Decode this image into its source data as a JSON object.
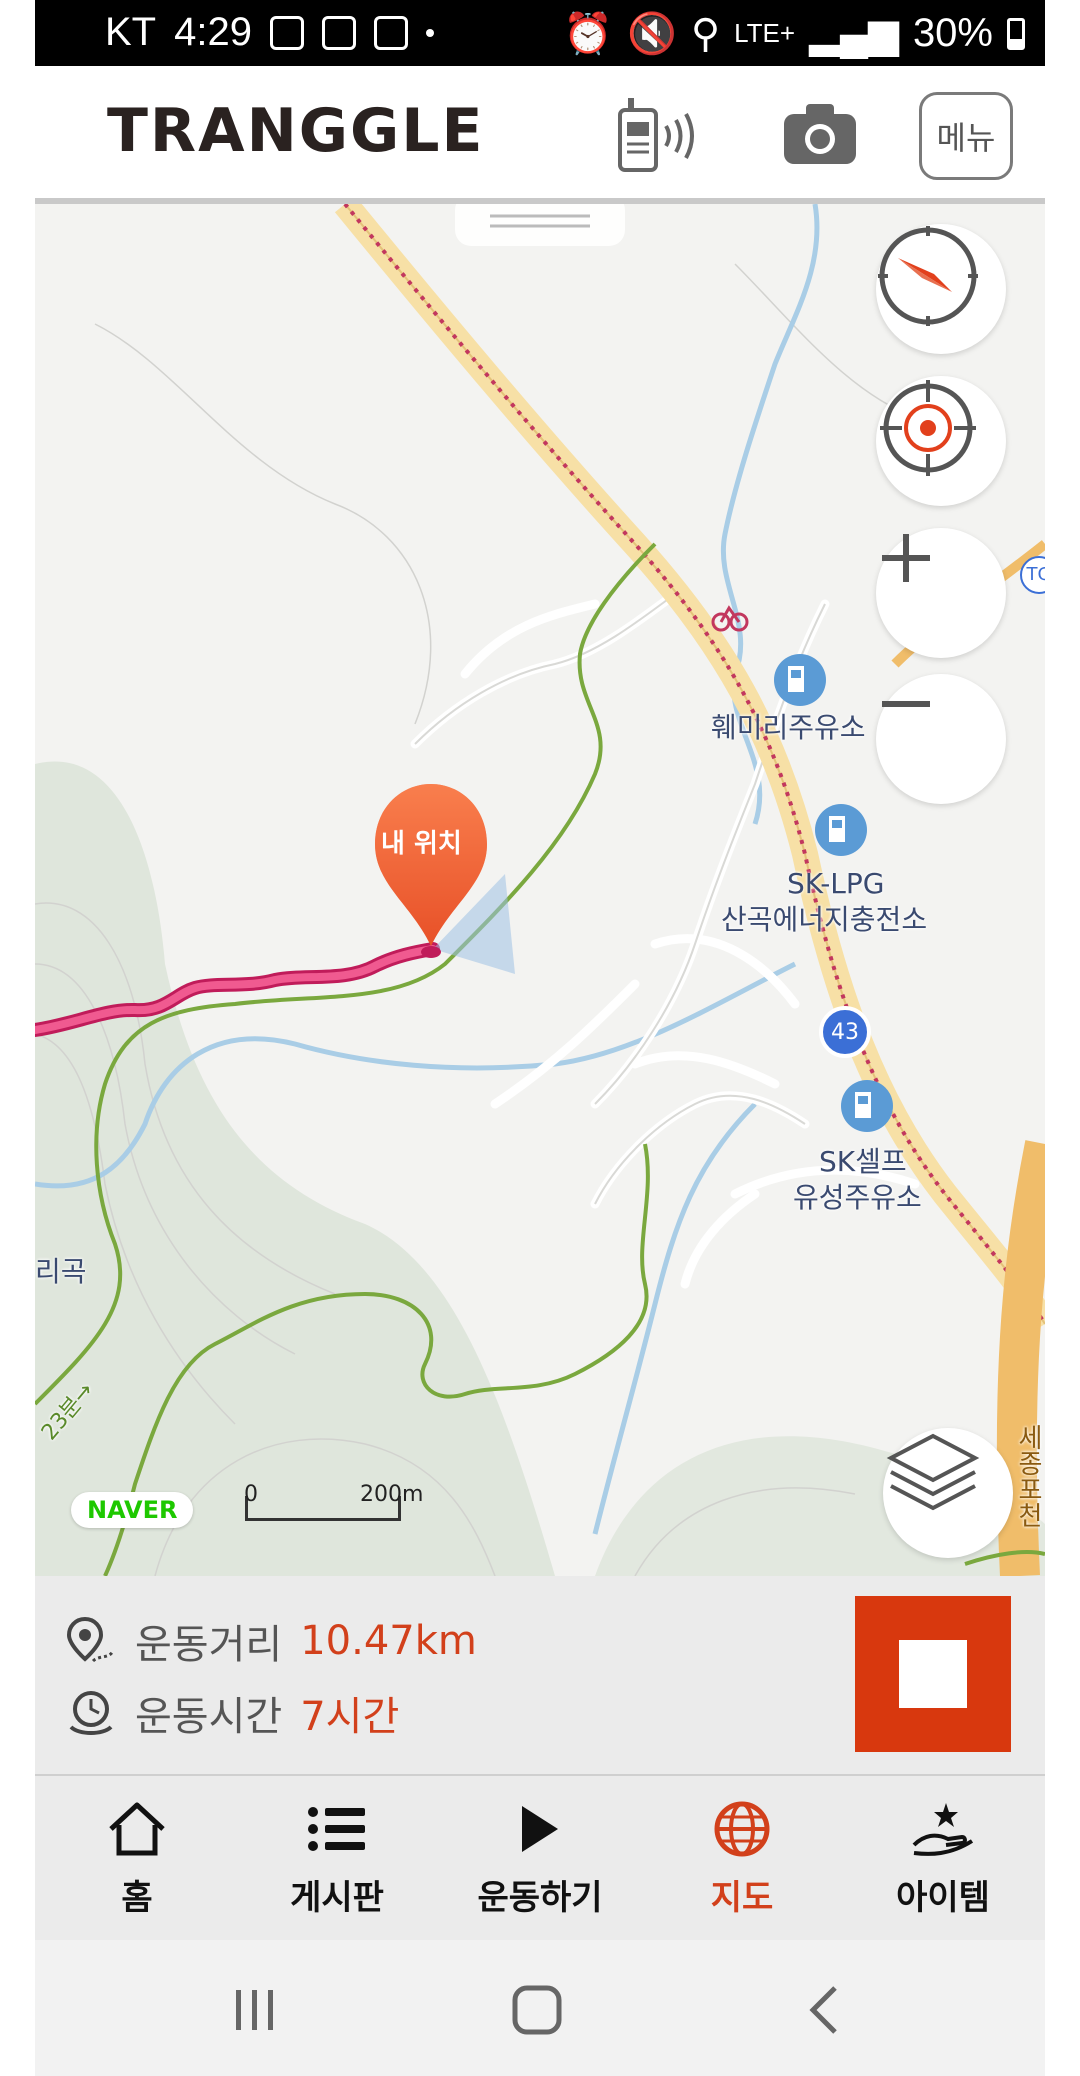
{
  "status_bar": {
    "carrier": "KT",
    "time": "4:29",
    "network": "LTE+",
    "battery": "30%"
  },
  "header": {
    "logo": "TRANGGLE",
    "menu_label": "메뉴"
  },
  "map": {
    "my_location_label": "내 위치",
    "labels": {
      "station1": "훼미리주유소",
      "station2_line1": "SK-LPG",
      "station2_line2": "산곡에너지충전소",
      "station3_line1": "SK셀프",
      "station3_line2": "유성주유소",
      "route_number": "43",
      "place_left": "리곡",
      "road_right": "세종포천",
      "trail_time": "23분→",
      "toll": "TG"
    },
    "naver": "NAVER",
    "scale_start": "0",
    "scale_end": "200m"
  },
  "info": {
    "distance_label": "운동거리",
    "distance_value": "10.47km",
    "time_label": "운동시간",
    "time_value": "7시간"
  },
  "bottom_nav": [
    {
      "label": "홈",
      "icon": "home-icon"
    },
    {
      "label": "게시판",
      "icon": "list-icon"
    },
    {
      "label": "운동하기",
      "icon": "play-icon"
    },
    {
      "label": "지도",
      "icon": "globe-icon",
      "active": true
    },
    {
      "label": "아이템",
      "icon": "hand-star-icon"
    }
  ],
  "colors": {
    "accent": "#d2401b",
    "route": "#e8336a",
    "trail": "#7aa83e"
  }
}
